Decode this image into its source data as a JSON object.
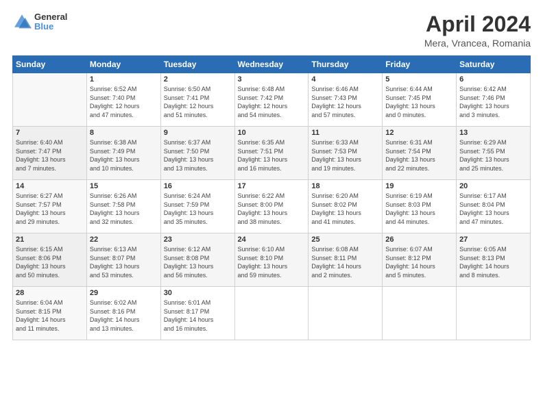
{
  "header": {
    "logo_line1": "General",
    "logo_line2": "Blue",
    "month": "April 2024",
    "location": "Mera, Vrancea, Romania"
  },
  "days_of_week": [
    "Sunday",
    "Monday",
    "Tuesday",
    "Wednesday",
    "Thursday",
    "Friday",
    "Saturday"
  ],
  "weeks": [
    [
      {
        "day": "",
        "info": ""
      },
      {
        "day": "1",
        "info": "Sunrise: 6:52 AM\nSunset: 7:40 PM\nDaylight: 12 hours\nand 47 minutes."
      },
      {
        "day": "2",
        "info": "Sunrise: 6:50 AM\nSunset: 7:41 PM\nDaylight: 12 hours\nand 51 minutes."
      },
      {
        "day": "3",
        "info": "Sunrise: 6:48 AM\nSunset: 7:42 PM\nDaylight: 12 hours\nand 54 minutes."
      },
      {
        "day": "4",
        "info": "Sunrise: 6:46 AM\nSunset: 7:43 PM\nDaylight: 12 hours\nand 57 minutes."
      },
      {
        "day": "5",
        "info": "Sunrise: 6:44 AM\nSunset: 7:45 PM\nDaylight: 13 hours\nand 0 minutes."
      },
      {
        "day": "6",
        "info": "Sunrise: 6:42 AM\nSunset: 7:46 PM\nDaylight: 13 hours\nand 3 minutes."
      }
    ],
    [
      {
        "day": "7",
        "info": "Sunrise: 6:40 AM\nSunset: 7:47 PM\nDaylight: 13 hours\nand 7 minutes."
      },
      {
        "day": "8",
        "info": "Sunrise: 6:38 AM\nSunset: 7:49 PM\nDaylight: 13 hours\nand 10 minutes."
      },
      {
        "day": "9",
        "info": "Sunrise: 6:37 AM\nSunset: 7:50 PM\nDaylight: 13 hours\nand 13 minutes."
      },
      {
        "day": "10",
        "info": "Sunrise: 6:35 AM\nSunset: 7:51 PM\nDaylight: 13 hours\nand 16 minutes."
      },
      {
        "day": "11",
        "info": "Sunrise: 6:33 AM\nSunset: 7:53 PM\nDaylight: 13 hours\nand 19 minutes."
      },
      {
        "day": "12",
        "info": "Sunrise: 6:31 AM\nSunset: 7:54 PM\nDaylight: 13 hours\nand 22 minutes."
      },
      {
        "day": "13",
        "info": "Sunrise: 6:29 AM\nSunset: 7:55 PM\nDaylight: 13 hours\nand 25 minutes."
      }
    ],
    [
      {
        "day": "14",
        "info": "Sunrise: 6:27 AM\nSunset: 7:57 PM\nDaylight: 13 hours\nand 29 minutes."
      },
      {
        "day": "15",
        "info": "Sunrise: 6:26 AM\nSunset: 7:58 PM\nDaylight: 13 hours\nand 32 minutes."
      },
      {
        "day": "16",
        "info": "Sunrise: 6:24 AM\nSunset: 7:59 PM\nDaylight: 13 hours\nand 35 minutes."
      },
      {
        "day": "17",
        "info": "Sunrise: 6:22 AM\nSunset: 8:00 PM\nDaylight: 13 hours\nand 38 minutes."
      },
      {
        "day": "18",
        "info": "Sunrise: 6:20 AM\nSunset: 8:02 PM\nDaylight: 13 hours\nand 41 minutes."
      },
      {
        "day": "19",
        "info": "Sunrise: 6:19 AM\nSunset: 8:03 PM\nDaylight: 13 hours\nand 44 minutes."
      },
      {
        "day": "20",
        "info": "Sunrise: 6:17 AM\nSunset: 8:04 PM\nDaylight: 13 hours\nand 47 minutes."
      }
    ],
    [
      {
        "day": "21",
        "info": "Sunrise: 6:15 AM\nSunset: 8:06 PM\nDaylight: 13 hours\nand 50 minutes."
      },
      {
        "day": "22",
        "info": "Sunrise: 6:13 AM\nSunset: 8:07 PM\nDaylight: 13 hours\nand 53 minutes."
      },
      {
        "day": "23",
        "info": "Sunrise: 6:12 AM\nSunset: 8:08 PM\nDaylight: 13 hours\nand 56 minutes."
      },
      {
        "day": "24",
        "info": "Sunrise: 6:10 AM\nSunset: 8:10 PM\nDaylight: 13 hours\nand 59 minutes."
      },
      {
        "day": "25",
        "info": "Sunrise: 6:08 AM\nSunset: 8:11 PM\nDaylight: 14 hours\nand 2 minutes."
      },
      {
        "day": "26",
        "info": "Sunrise: 6:07 AM\nSunset: 8:12 PM\nDaylight: 14 hours\nand 5 minutes."
      },
      {
        "day": "27",
        "info": "Sunrise: 6:05 AM\nSunset: 8:13 PM\nDaylight: 14 hours\nand 8 minutes."
      }
    ],
    [
      {
        "day": "28",
        "info": "Sunrise: 6:04 AM\nSunset: 8:15 PM\nDaylight: 14 hours\nand 11 minutes."
      },
      {
        "day": "29",
        "info": "Sunrise: 6:02 AM\nSunset: 8:16 PM\nDaylight: 14 hours\nand 13 minutes."
      },
      {
        "day": "30",
        "info": "Sunrise: 6:01 AM\nSunset: 8:17 PM\nDaylight: 14 hours\nand 16 minutes."
      },
      {
        "day": "",
        "info": ""
      },
      {
        "day": "",
        "info": ""
      },
      {
        "day": "",
        "info": ""
      },
      {
        "day": "",
        "info": ""
      }
    ]
  ]
}
